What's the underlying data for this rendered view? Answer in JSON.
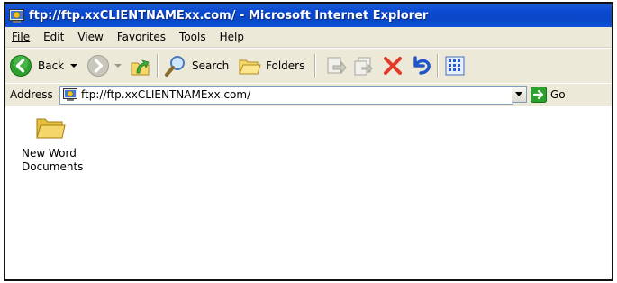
{
  "window": {
    "title": "ftp://ftp.xxCLIENTNAMExx.com/ - Microsoft Internet Explorer"
  },
  "menu": {
    "file": "File",
    "edit": "Edit",
    "view": "View",
    "favorites": "Favorites",
    "tools": "Tools",
    "help": "Help"
  },
  "toolbar": {
    "back_label": "Back",
    "search_label": "Search",
    "folders_label": "Folders"
  },
  "address": {
    "label": "Address",
    "url": "ftp://ftp.xxCLIENTNAMExx.com/",
    "go_label": "Go"
  },
  "content": {
    "items": [
      {
        "label_line1": "New Word",
        "label_line2": "Documents",
        "icon": "folder-icon"
      }
    ]
  },
  "colors": {
    "titlebar": "#0a47c8",
    "chrome": "#ece9d8",
    "back_green": "#2da12d",
    "delete_red": "#e23b2a",
    "folder_yellow": "#f5d66a"
  }
}
